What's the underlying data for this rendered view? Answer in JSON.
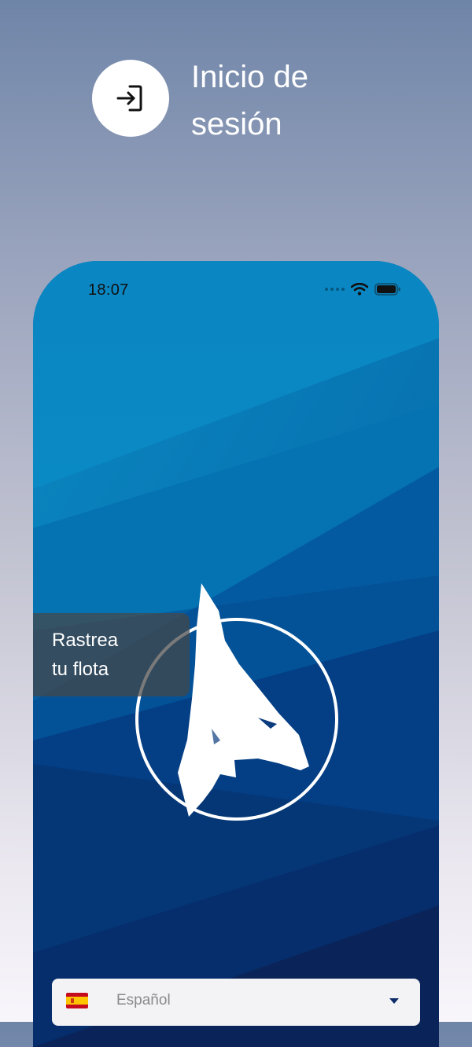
{
  "header": {
    "icon": "login-icon",
    "title_line1": "Inicio de",
    "title_line2": "sesión"
  },
  "status_bar": {
    "time": "18:07",
    "icons": [
      "signal-dots-icon",
      "wifi-icon",
      "battery-icon"
    ]
  },
  "logo": {
    "icon": "wolf-logo-icon"
  },
  "promo": {
    "line1": "Rastrea",
    "line2": "tu flota"
  },
  "language_select": {
    "flag_icon": "spain-flag-icon",
    "selected": "Español",
    "chevron_icon": "chevron-down-icon"
  },
  "colors": {
    "background_top": "#6f85a8",
    "background_bottom": "#f8f6fb",
    "phone_blue": "#0067a6",
    "phone_deep_blue": "#0b2c69"
  }
}
